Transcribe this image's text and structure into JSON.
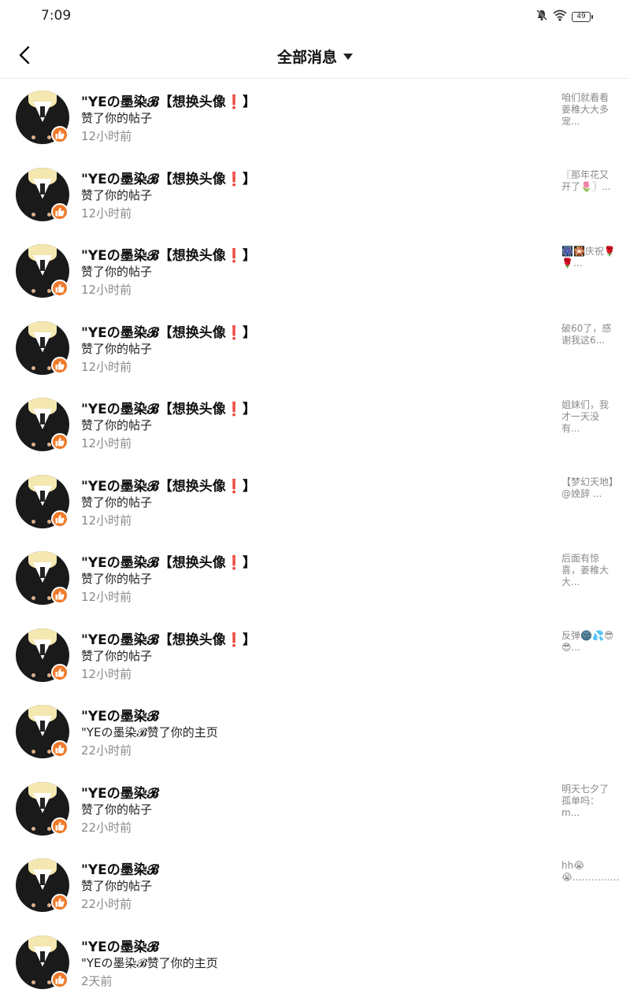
{
  "status_bar": {
    "time": "7:09",
    "battery": "49",
    "icons": [
      "bell-off-icon",
      "wifi-icon",
      "battery-icon"
    ]
  },
  "header": {
    "title": "全部消息",
    "back_icon": "chevron-left-icon",
    "dropdown_icon": "caret-down-icon"
  },
  "colors": {
    "accent": "#f07a2a",
    "secondary_text": "#8a8a8a"
  },
  "messages": [
    {
      "name": "\"YEの墨染𝓑【想换头像❗】",
      "action": "赞了你的帖子",
      "time": "12小时前",
      "preview": "咱们就看看姜稚大大多宠..."
    },
    {
      "name": "\"YEの墨染𝓑【想换头像❗】",
      "action": "赞了你的帖子",
      "time": "12小时前",
      "preview": "〖那年花又开了🌷〗..."
    },
    {
      "name": "\"YEの墨染𝓑【想换头像❗】",
      "action": "赞了你的帖子",
      "time": "12小时前",
      "preview": "🎆🎇庆祝🌹🌹..."
    },
    {
      "name": "\"YEの墨染𝓑【想换头像❗】",
      "action": "赞了你的帖子",
      "time": "12小时前",
      "preview": "破60了，感谢我这6..."
    },
    {
      "name": "\"YEの墨染𝓑【想换头像❗】",
      "action": "赞了你的帖子",
      "time": "12小时前",
      "preview": "姐妹们，我才一天没有..."
    },
    {
      "name": "\"YEの墨染𝓑【想换头像❗】",
      "action": "赞了你的帖子",
      "time": "12小时前",
      "preview": "【梦幻天地】@娩辞 ..."
    },
    {
      "name": "\"YEの墨染𝓑【想换头像❗】",
      "action": "赞了你的帖子",
      "time": "12小时前",
      "preview": "后面有惊喜，姜稚大大..."
    },
    {
      "name": "\"YEの墨染𝓑【想换头像❗】",
      "action": "赞了你的帖子",
      "time": "12小时前",
      "preview": "反弹🌚💦😎😎..."
    },
    {
      "name": "\"YEの墨染𝓑",
      "action": "\"YEの墨染𝓑赞了你的主页",
      "time": "22小时前",
      "preview": ""
    },
    {
      "name": "\"YEの墨染𝓑",
      "action": "赞了你的帖子",
      "time": "22小时前",
      "preview": "明天七夕了孤单吗：m..."
    },
    {
      "name": "\"YEの墨染𝓑",
      "action": "赞了你的帖子",
      "time": "22小时前",
      "preview": "hh😭😭...…………"
    },
    {
      "name": "\"YEの墨染𝓑",
      "action": "\"YEの墨染𝓑赞了你的主页",
      "time": "2天前",
      "preview": ""
    }
  ]
}
